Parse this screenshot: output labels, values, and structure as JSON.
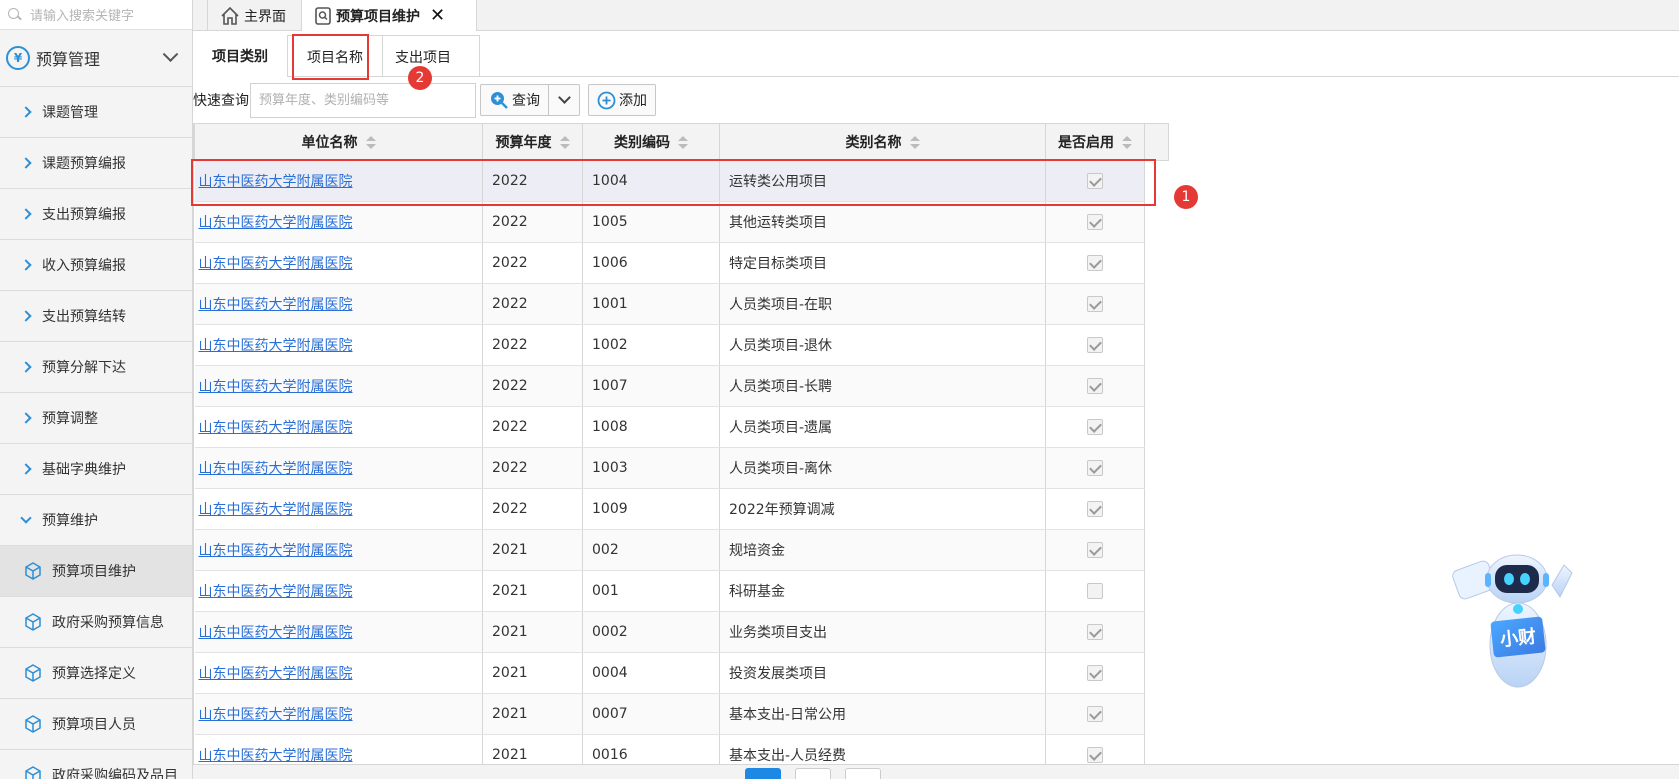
{
  "sidebar": {
    "search_placeholder": "请输入搜索关键字",
    "module_title": "预算管理",
    "items": [
      {
        "label": "课题管理"
      },
      {
        "label": "课题预算编报"
      },
      {
        "label": "支出预算编报"
      },
      {
        "label": "收入预算编报"
      },
      {
        "label": "支出预算结转"
      },
      {
        "label": "预算分解下达"
      },
      {
        "label": "预算调整"
      },
      {
        "label": "基础字典维护"
      },
      {
        "label": "预算维护"
      }
    ],
    "sub_items": [
      {
        "label": "预算项目维护"
      },
      {
        "label": "政府采购预算信息"
      },
      {
        "label": "预算选择定义"
      },
      {
        "label": "预算项目人员"
      },
      {
        "label": "政府采购编码及品目"
      }
    ]
  },
  "top_tabs": {
    "home": "主界面",
    "current": "预算项目维护"
  },
  "sub_tabs": [
    "项目类别",
    "项目名称",
    "支出项目"
  ],
  "toolbar": {
    "quick_label": "快速查询",
    "quick_placeholder": "预算年度、类别编码等",
    "query_label": "查询",
    "add_label": "添加"
  },
  "table": {
    "headers": [
      "单位名称",
      "预算年度",
      "类别编码",
      "类别名称",
      "是否启用"
    ],
    "rows": [
      {
        "unit": "山东中医药大学附属医院",
        "year": "2022",
        "code": "1004",
        "name": "运转类公用项目",
        "enabled": true
      },
      {
        "unit": "山东中医药大学附属医院",
        "year": "2022",
        "code": "1005",
        "name": "其他运转类项目",
        "enabled": true
      },
      {
        "unit": "山东中医药大学附属医院",
        "year": "2022",
        "code": "1006",
        "name": "特定目标类项目",
        "enabled": true
      },
      {
        "unit": "山东中医药大学附属医院",
        "year": "2022",
        "code": "1001",
        "name": "人员类项目-在职",
        "enabled": true
      },
      {
        "unit": "山东中医药大学附属医院",
        "year": "2022",
        "code": "1002",
        "name": "人员类项目-退休",
        "enabled": true
      },
      {
        "unit": "山东中医药大学附属医院",
        "year": "2022",
        "code": "1007",
        "name": "人员类项目-长聘",
        "enabled": true
      },
      {
        "unit": "山东中医药大学附属医院",
        "year": "2022",
        "code": "1008",
        "name": "人员类项目-遗属",
        "enabled": true
      },
      {
        "unit": "山东中医药大学附属医院",
        "year": "2022",
        "code": "1003",
        "name": "人员类项目-离休",
        "enabled": true
      },
      {
        "unit": "山东中医药大学附属医院",
        "year": "2022",
        "code": "1009",
        "name": "2022年预算调减",
        "enabled": true
      },
      {
        "unit": "山东中医药大学附属医院",
        "year": "2021",
        "code": "002",
        "name": "规培资金",
        "enabled": true
      },
      {
        "unit": "山东中医药大学附属医院",
        "year": "2021",
        "code": "001",
        "name": "科研基金",
        "enabled": false
      },
      {
        "unit": "山东中医药大学附属医院",
        "year": "2021",
        "code": "0002",
        "name": "业务类项目支出",
        "enabled": true
      },
      {
        "unit": "山东中医药大学附属医院",
        "year": "2021",
        "code": "0004",
        "name": "投资发展类项目",
        "enabled": true
      },
      {
        "unit": "山东中医药大学附属医院",
        "year": "2021",
        "code": "0007",
        "name": "基本支出-日常公用",
        "enabled": true
      },
      {
        "unit": "山东中医药大学附属医院",
        "year": "2021",
        "code": "0016",
        "name": "基本支出-人员经费",
        "enabled": true
      }
    ]
  },
  "annotations": {
    "badge1": "1",
    "badge2": "2"
  },
  "robot_label": "小财",
  "colors": {
    "accent": "#2d8fd5",
    "highlight": "#e53935",
    "link": "#2a6fd6"
  }
}
